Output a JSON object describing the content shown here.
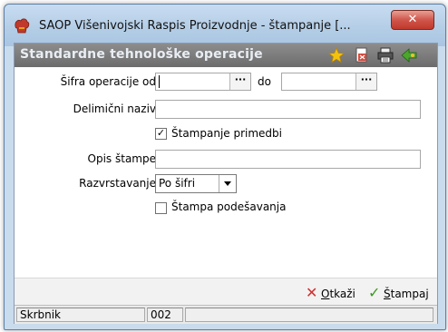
{
  "window": {
    "title": "SAOP  Višenivojski Raspis Proizvodnje - štampanje  [...",
    "close_glyph": "✕"
  },
  "panel": {
    "title": "Standardne tehnološke operacije",
    "icons": [
      "star-icon",
      "pdf-export-icon",
      "printer-icon",
      "exit-icon"
    ]
  },
  "form": {
    "sifra_label": "Šifra operacije od",
    "sifra_from_value": "",
    "lookup_glyph": "···",
    "do_label": "do",
    "sifra_to_value": "",
    "delimicni_label": "Delimični naziv",
    "delimicni_value": "",
    "stampanje_primedbi_label": "Štampanje primedbi",
    "stampanje_primedbi_checked": true,
    "check_glyph": "✓",
    "opis_label": "Opis štampe",
    "opis_value": "",
    "razvrstavanje_label": "Razvrstavanje",
    "razvrstavanje_value": "Po šifri",
    "stampa_podesavanja_label": "Štampa podešavanja",
    "stampa_podesavanja_checked": false
  },
  "buttons": {
    "cancel_underlined": "O",
    "cancel_rest": "tkaži",
    "cancel_glyph": "✕",
    "print_underlined": "Š",
    "print_rest": "tampaj",
    "print_glyph": "✓",
    "cancel_color": "#d03030",
    "print_color": "#3a9a1e"
  },
  "status": {
    "user": "Skrbnik",
    "code": "002",
    "extra": ""
  }
}
